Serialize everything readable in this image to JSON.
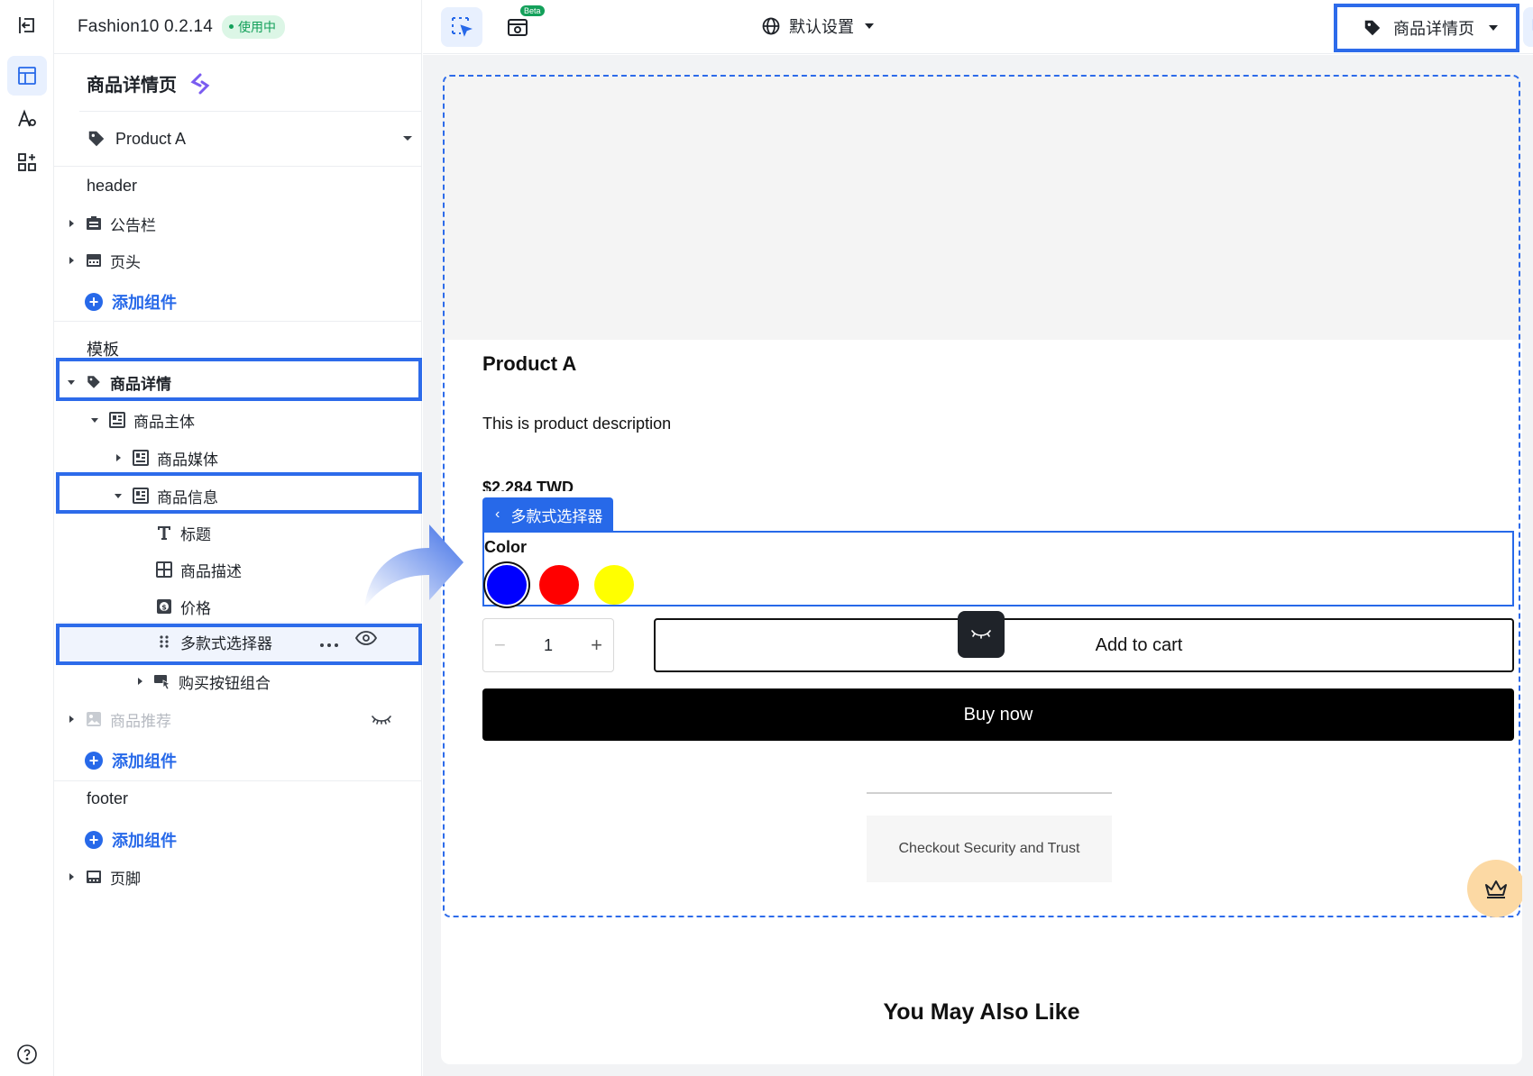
{
  "app": {
    "name": "Fashion10 0.2.14",
    "status": "使用中"
  },
  "sidebar": {
    "page_title": "商品详情页",
    "product_select": "Product A",
    "sections": {
      "header": "header",
      "template": "模板",
      "footer": "footer"
    },
    "add_component": "添加组件",
    "header_items": [
      {
        "label": "公告栏",
        "icon": "announcement-icon"
      },
      {
        "label": "页头",
        "icon": "header-icon"
      }
    ],
    "template_items": [
      {
        "label": "商品详情",
        "icon": "tag-icon"
      },
      {
        "label": "商品主体",
        "icon": "layout-icon"
      },
      {
        "label": "商品媒体",
        "icon": "layout-icon"
      },
      {
        "label": "商品信息",
        "icon": "layout-icon"
      },
      {
        "label": "标题",
        "icon": "text-icon"
      },
      {
        "label": "商品描述",
        "icon": "grid-icon"
      },
      {
        "label": "价格",
        "icon": "price-icon"
      },
      {
        "label": "多款式选择器",
        "icon": "drag-icon"
      },
      {
        "label": "购买按钮组合",
        "icon": "buy-button-icon"
      },
      {
        "label": "商品推荐",
        "icon": "image-icon"
      }
    ],
    "footer_items": [
      {
        "label": "页脚",
        "icon": "footer-icon"
      }
    ]
  },
  "toolbar": {
    "beta": "Beta",
    "language": "默认设置",
    "page": "商品详情页"
  },
  "preview": {
    "product_title": "Product A",
    "description": "This is product description",
    "price": "$2,284 TWD",
    "variant_selector_label": "多款式选择器",
    "option_label": "Color",
    "colors": [
      "#0000ff",
      "#ff0000",
      "#ffff00"
    ],
    "quantity": "1",
    "add_to_cart": "Add to cart",
    "buy_now": "Buy now",
    "trust": "Checkout Security and Trust",
    "also_like": "You May Also Like"
  },
  "colors": {
    "accent": "#2769e9",
    "highlight": "#2d6bea",
    "status_green": "#13a05a"
  }
}
